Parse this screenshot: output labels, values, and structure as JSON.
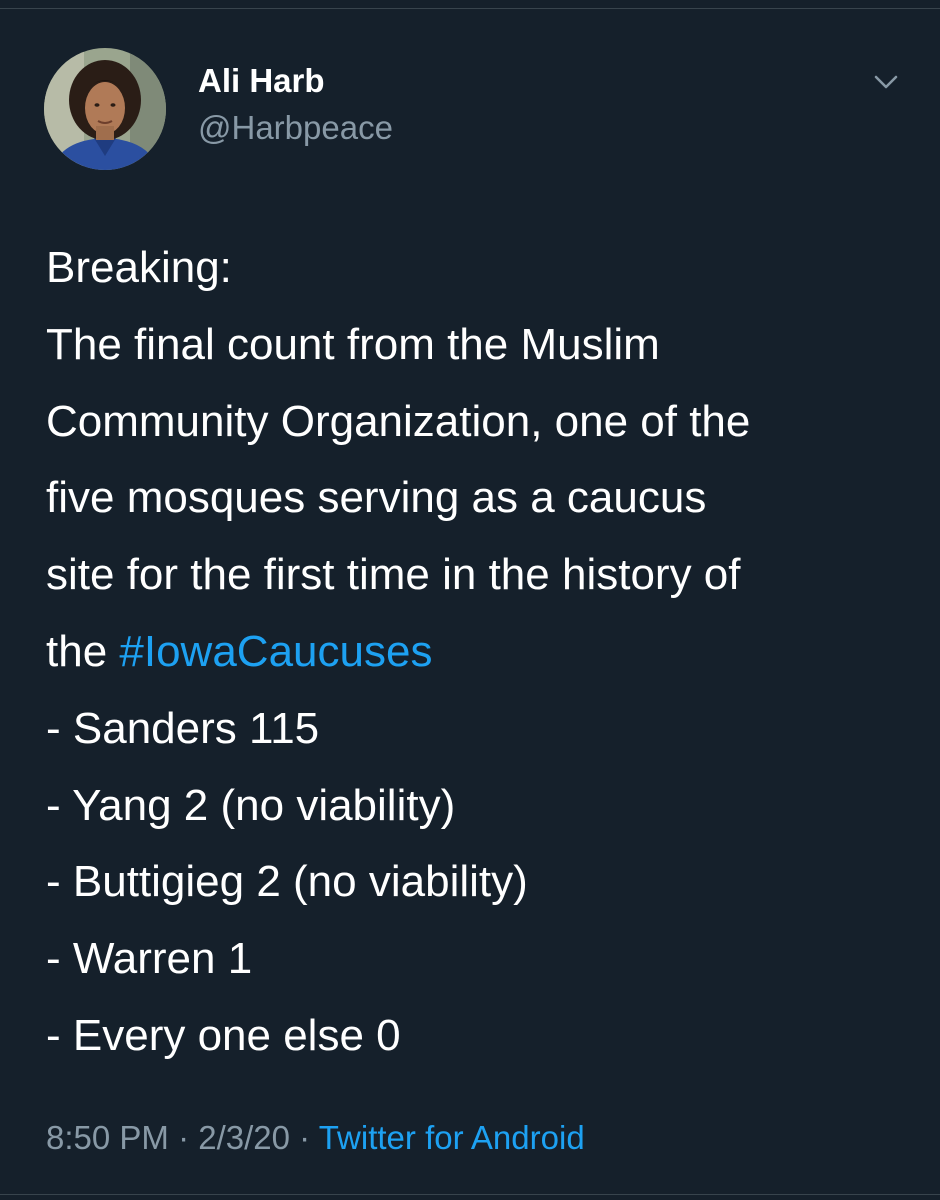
{
  "tweet": {
    "author": {
      "name": "Ali Harb",
      "handle": "@Harbpeace"
    },
    "lines": {
      "l1": "Breaking:",
      "l2": "The final count from the Muslim",
      "l3": "Community Organization, one of the",
      "l4": "five mosques serving as a caucus",
      "l5": "site for the first time in the history of",
      "l6_prefix": "the ",
      "hashtag": "#IowaCaucuses",
      "l7": "- Sanders 115",
      "l8": "- Yang 2 (no viability)",
      "l9": "- Buttigieg 2 (no viability)",
      "l10": "- Warren 1",
      "l11": "- Every one else 0"
    },
    "time": "8:50 PM",
    "separator": " · ",
    "date": "2/3/20",
    "source": "Twitter for Android"
  },
  "icons": {
    "menu": "chevron-down-icon"
  },
  "colors": {
    "background": "#15202b",
    "text": "#ffffff",
    "secondary": "#8899a6",
    "accent": "#1da1f2",
    "divider": "#38444d"
  }
}
